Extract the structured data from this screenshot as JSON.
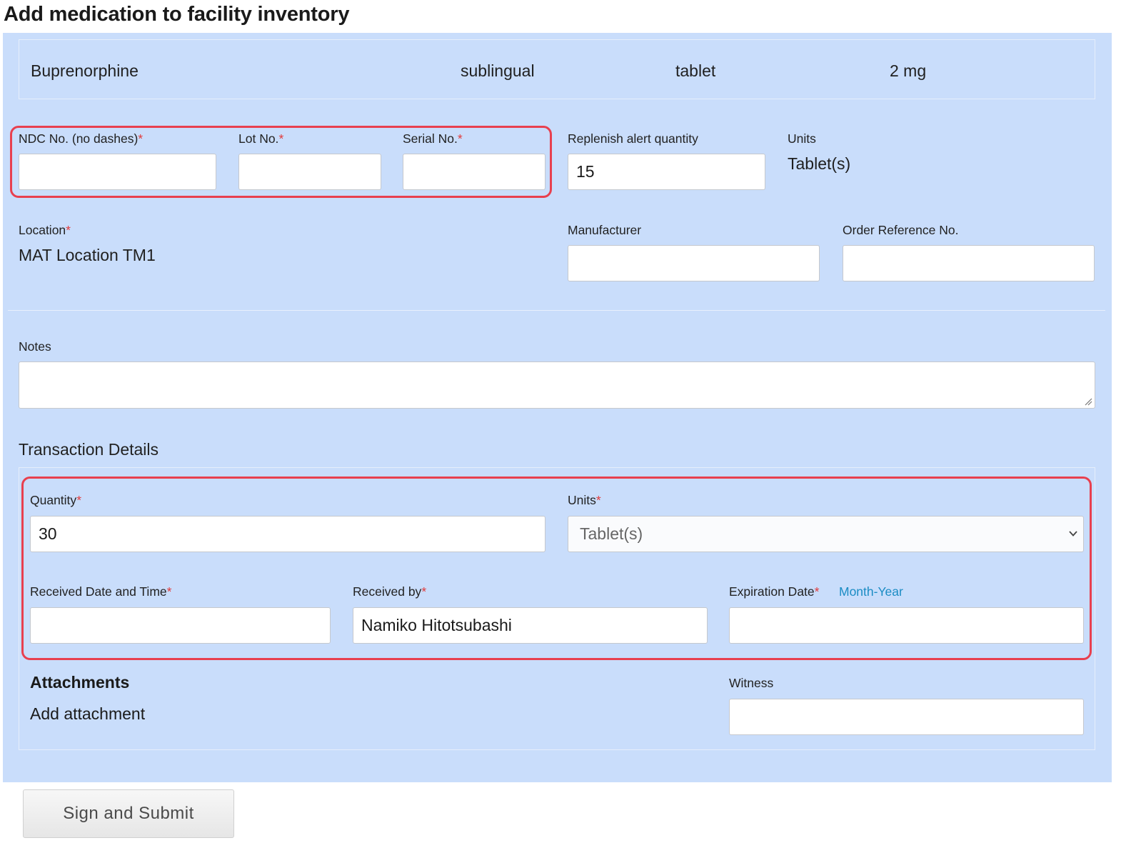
{
  "page": {
    "title": "Add medication to facility inventory"
  },
  "medication": {
    "name": "Buprenorphine",
    "route": "sublingual",
    "form": "tablet",
    "strength": "2 mg"
  },
  "identifiers": {
    "ndc_label": "NDC No. (no dashes)",
    "ndc_value": "",
    "lot_label": "Lot No.",
    "lot_value": "",
    "serial_label": "Serial No.",
    "serial_value": "",
    "required_marker": "*"
  },
  "replenish": {
    "label": "Replenish alert quantity",
    "value": "15"
  },
  "units_info": {
    "label": "Units",
    "value": "Tablet(s)"
  },
  "location": {
    "label": "Location",
    "value": "MAT Location TM1"
  },
  "manufacturer": {
    "label": "Manufacturer",
    "value": ""
  },
  "order_ref": {
    "label": "Order Reference No.",
    "value": ""
  },
  "notes": {
    "label": "Notes",
    "value": ""
  },
  "transaction": {
    "heading": "Transaction Details",
    "quantity_label": "Quantity",
    "quantity_value": "30",
    "units_label": "Units",
    "units_selected": "Tablet(s)",
    "received_date_label": "Received Date and Time",
    "received_date_value": "",
    "received_by_label": "Received by",
    "received_by_value": "Namiko Hitotsubashi",
    "expiration_label": "Expiration Date",
    "expiration_hint": "Month-Year",
    "expiration_value": ""
  },
  "attachments": {
    "heading": "Attachments",
    "add_link": "Add attachment"
  },
  "witness": {
    "label": "Witness",
    "value": ""
  },
  "actions": {
    "submit_label": "Sign and Submit"
  },
  "colors": {
    "panel_bg": "#c9ddfb",
    "highlight_border": "#e8404f",
    "required_asterisk": "#e23a3a",
    "hint_link": "#1b8cc4"
  }
}
